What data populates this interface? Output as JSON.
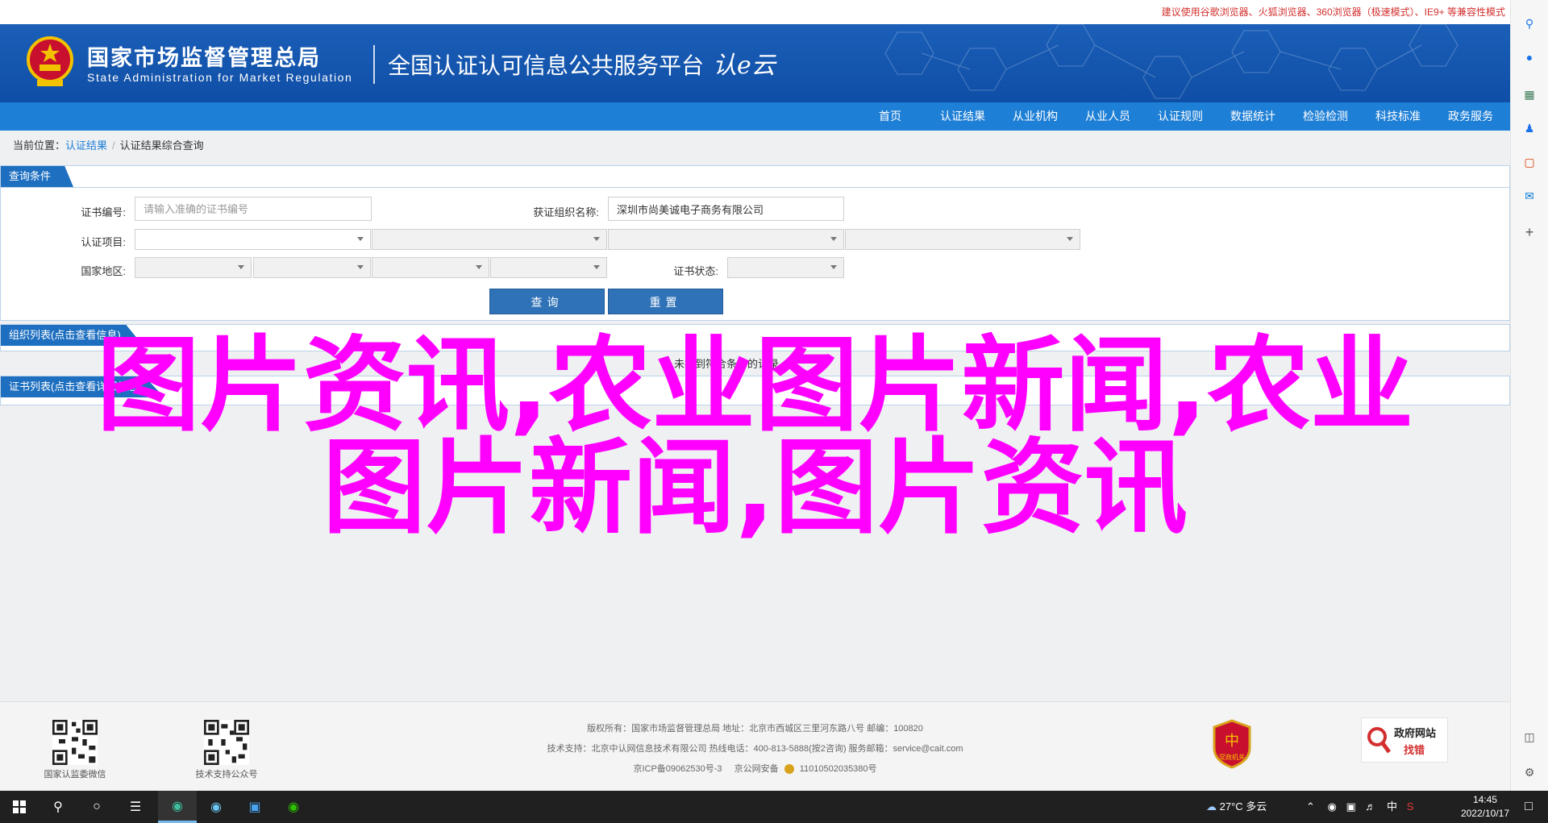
{
  "browser_hint": "建议使用谷歌浏览器、火狐浏览器、360浏览器（极速模式）、IE9+ 等兼容性模式",
  "header": {
    "org_cn": "国家市场监督管理总局",
    "org_en": "State Administration  for  Market Regulation",
    "platform": "全国认证认可信息公共服务平台",
    "logo_script": "认e云"
  },
  "nav": [
    "首页",
    "认证结果",
    "从业机构",
    "从业人员",
    "认证规则",
    "数据统计",
    "检验检测",
    "科技标准",
    "政务服务"
  ],
  "breadcrumb": {
    "prefix": "当前位置：",
    "level1": "认证结果",
    "level2": "认证结果综合查询"
  },
  "query_panel": {
    "title": "查询条件",
    "cert_no_label": "证书编号:",
    "cert_no_placeholder": "请输入准确的证书编号",
    "org_label": "获证组织名称:",
    "org_value": "深圳市尚美诚电子商务有限公司",
    "project_label": "认证项目:",
    "region_label": "国家地区:",
    "status_label": "证书状态:",
    "search_btn": "查询",
    "reset_btn": "重置"
  },
  "org_panel": {
    "title": "组织列表(点击查看信息)",
    "note": "未找到符合条件的记录"
  },
  "cert_panel": {
    "title": "证书列表(点击查看详细信息)"
  },
  "overlay": {
    "line1": "图片资讯,农业图片新闻,农业",
    "line2": "图片新闻,图片资讯"
  },
  "footer": {
    "qr1_caption": "国家认监委微信",
    "qr2_caption": "技术支持公众号",
    "line1": "版权所有：国家市场监督管理总局    地址：北京市西城区三里河东路八号    邮编：100820",
    "line2": "技术支持：北京中认网信息技术有限公司    热线电话：400-813-5888(按2咨询)    服务邮箱：service@cait.com",
    "line3_icp": "京ICP备09062530号-3",
    "line3_police": "京公网安备",
    "line3_police_no": "11010502035380号",
    "badge_text": "党政机关",
    "gov_find_top": "政府网站",
    "gov_find_bottom": "找错"
  },
  "taskbar": {
    "weather": "27°C  多云",
    "ime": "中",
    "time": "14:45",
    "date": "2022/10/17"
  },
  "colors": {
    "nav_blue": "#1e7fd6",
    "banner_blue": "#0f4ea6",
    "overlay_magenta": "#ff00ff"
  }
}
